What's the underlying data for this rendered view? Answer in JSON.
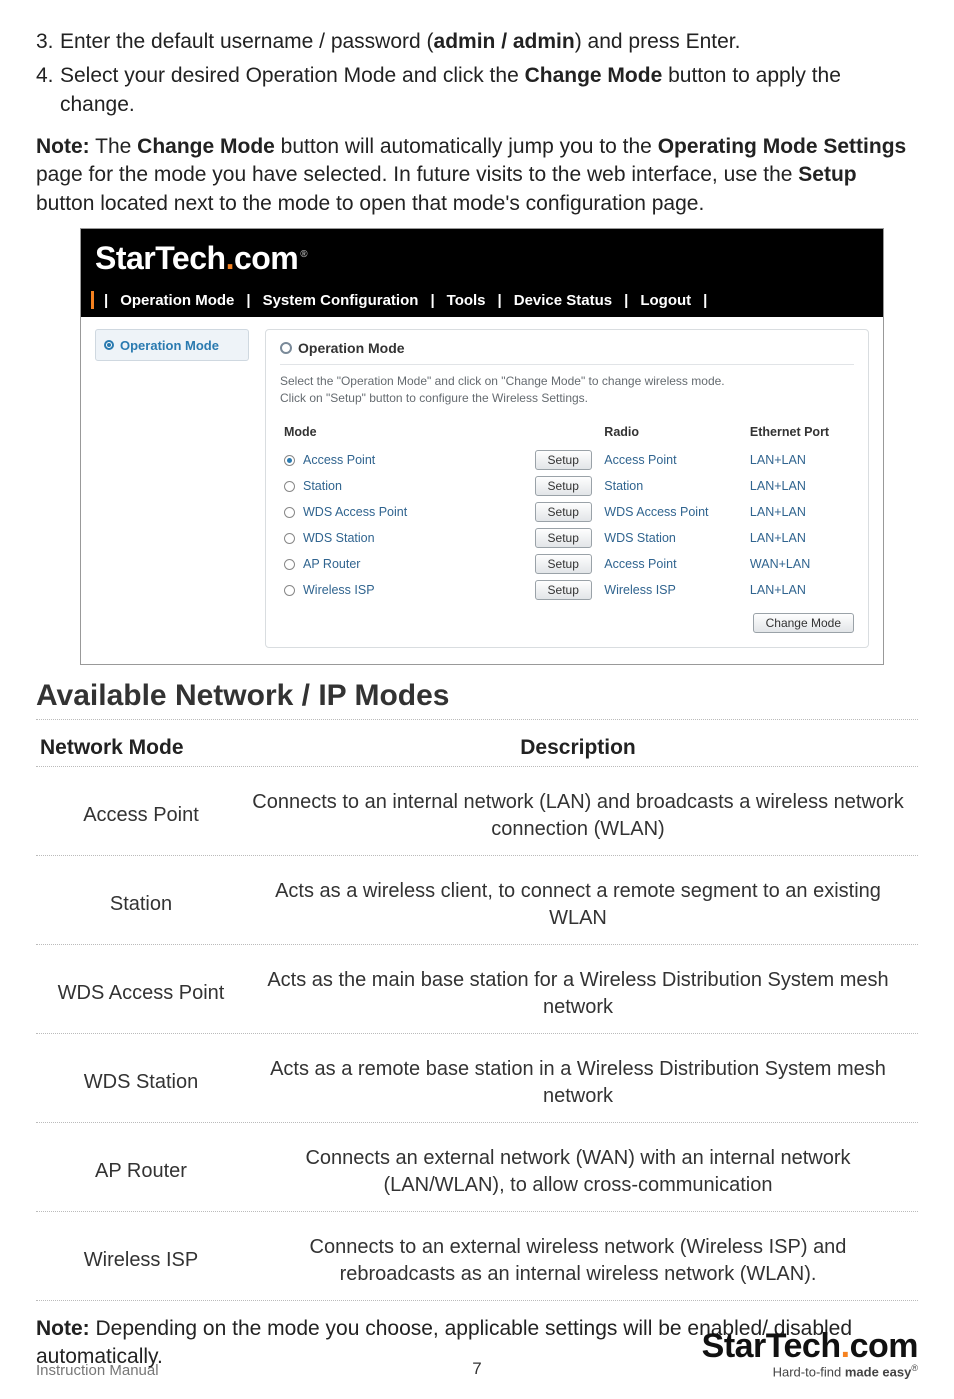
{
  "steps": [
    {
      "num": "3.",
      "before": "Enter the default username / password (",
      "bold": "admin / admin",
      "after": ") and press Enter."
    },
    {
      "num": "4.",
      "before": "Select your desired Operation Mode and click the ",
      "bold": "Change Mode",
      "after": " button to apply the change."
    }
  ],
  "note1": {
    "label": "Note:",
    "p1": " The ",
    "b1": "Change Mode",
    "p2": " button will automatically jump you to the ",
    "b2": "Operating Mode Settings",
    "p3": " page for the mode you have selected. In future visits to the web interface, use the ",
    "b3": "Setup",
    "p4": " button located next to the mode to open that mode's configuration page."
  },
  "shot": {
    "brand_a": "StarTech",
    "brand_b": "com",
    "brand_reg": "®",
    "nav": [
      "Operation Mode",
      "System Configuration",
      "Tools",
      "Device Status",
      "Logout"
    ],
    "side_label": "Operation Mode",
    "panel_title": "Operation Mode",
    "hint1": "Select the \"Operation Mode\" and click on \"Change Mode\" to change wireless mode.",
    "hint2": "Click on \"Setup\" button to configure the Wireless Settings.",
    "headers": {
      "mode": "Mode",
      "radio": "Radio",
      "eth": "Ethernet Port"
    },
    "setup_label": "Setup",
    "change_label": "Change Mode",
    "rows": [
      {
        "checked": true,
        "mode": "Access Point",
        "radio": "Access Point",
        "eth": "LAN+LAN"
      },
      {
        "checked": false,
        "mode": "Station",
        "radio": "Station",
        "eth": "LAN+LAN"
      },
      {
        "checked": false,
        "mode": "WDS Access Point",
        "radio": "WDS Access Point",
        "eth": "LAN+LAN"
      },
      {
        "checked": false,
        "mode": "WDS Station",
        "radio": "WDS Station",
        "eth": "LAN+LAN"
      },
      {
        "checked": false,
        "mode": "AP Router",
        "radio": "Access Point",
        "eth": "WAN+LAN"
      },
      {
        "checked": false,
        "mode": "Wireless ISP",
        "radio": "Wireless ISP",
        "eth": "LAN+LAN"
      }
    ]
  },
  "section_title": "Available Network / IP Modes",
  "nm": {
    "h1": "Network Mode",
    "h2": "Description",
    "rows": [
      {
        "mode": "Access Point",
        "desc": "Connects to an internal network (LAN) and broadcasts a wireless network connection (WLAN)"
      },
      {
        "mode": "Station",
        "desc": "Acts as a wireless client, to connect a remote segment to an existing WLAN"
      },
      {
        "mode": "WDS Access Point",
        "desc": "Acts as the main base station  for a Wireless Distribution System mesh network"
      },
      {
        "mode": "WDS Station",
        "desc": "Acts as a remote base station in a Wireless Distribution System mesh network"
      },
      {
        "mode": "AP Router",
        "desc": "Connects an external network (WAN) with an internal network (LAN/WLAN), to allow cross-communication"
      },
      {
        "mode": "Wireless ISP",
        "desc": "Connects to an external wireless network (Wireless ISP) and rebroadcasts as an internal wireless network (WLAN)."
      }
    ]
  },
  "note2": {
    "label": "Note:",
    "text": " Depending on the mode you choose, applicable settings will be enabled/ disabled automatically."
  },
  "footer": {
    "im": "Instruction Manual",
    "page": "7",
    "brand_a": "StarTech",
    "brand_b": "com",
    "tag_a": "Hard-to-find ",
    "tag_b": "made easy",
    "reg": "®"
  }
}
